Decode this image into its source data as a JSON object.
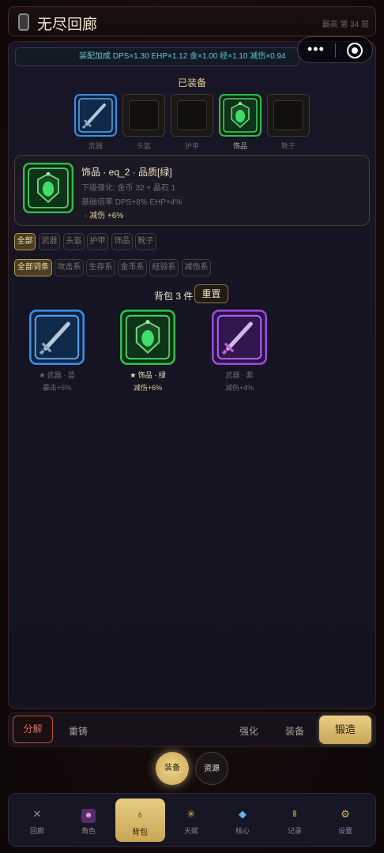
{
  "header": {
    "title": "无尽回廊",
    "floor": "最高 第 34 层"
  },
  "bonus_bar": "装配加成 DPS×1.30 EHP×1.12 金×1.00 经×1.10 减伤×0.94",
  "equipped": {
    "title": "已装备",
    "slots": [
      {
        "label": "武器",
        "filled": true,
        "rarity": "blue",
        "icon": "sword-icon"
      },
      {
        "label": "头盔",
        "filled": false
      },
      {
        "label": "护甲",
        "filled": false
      },
      {
        "label": "饰品",
        "filled": true,
        "rarity": "green",
        "icon": "amulet-icon"
      },
      {
        "label": "靴子",
        "filled": false
      }
    ]
  },
  "detail": {
    "title": "饰品 · eq_2 · 品质[绿]",
    "next_upgrade": "下级强化: 金币 32 + 晶石 1",
    "base_rate": "基础倍率 DPS+8% EHP+4%",
    "affix": "· 减伤 +6%",
    "icon": "amulet-icon"
  },
  "filters": {
    "slots": [
      "全部",
      "武器",
      "头盔",
      "护甲",
      "饰品",
      "靴子"
    ],
    "slots_active": "全部",
    "affixes": [
      "全部词条",
      "攻击系",
      "生存系",
      "金币系",
      "经验系",
      "减伤系"
    ],
    "affixes_active": "全部词条"
  },
  "bag": {
    "title": "背包 3 件",
    "reset_label": "重置",
    "items": [
      {
        "label": "★ 武器 · 蓝",
        "affix": "暴击+6%",
        "rarity": "blue",
        "icon": "sword-icon"
      },
      {
        "label": "★ 饰品 · 绿",
        "affix": "减伤+6%",
        "rarity": "green",
        "icon": "amulet-icon"
      },
      {
        "label": "武器 · 紫",
        "affix": "减伤+4%",
        "rarity": "purple",
        "icon": "sword-icon"
      }
    ]
  },
  "actions": {
    "decompose": "分解",
    "reforge": "重铸",
    "enhance": "强化",
    "equip": "装备",
    "forge": "锻造"
  },
  "subtabs": {
    "equipment": "装备",
    "resources": "资源"
  },
  "nav": [
    {
      "label": "回廊",
      "icon": "crossed-swords-icon",
      "color": "#9a8e80"
    },
    {
      "label": "角色",
      "icon": "character-icon",
      "color": "#c28bd8"
    },
    {
      "label": "背包",
      "icon": "bag-icon",
      "color": "#2a1e0a"
    },
    {
      "label": "天赋",
      "icon": "star-burst-icon",
      "color": "#d9b24a"
    },
    {
      "label": "核心",
      "icon": "diamond-icon",
      "color": "#6ab0e6"
    },
    {
      "label": "记录",
      "icon": "scroll-icon",
      "color": "#d9b24a"
    },
    {
      "label": "设置",
      "icon": "gear-icon",
      "color": "#d9b24a"
    }
  ],
  "colors": {
    "gold": "#e6cf92",
    "blue": "#3a8ee6",
    "green": "#2fbf4a",
    "purple": "#9a4ae0",
    "red": "#c24a4a"
  }
}
